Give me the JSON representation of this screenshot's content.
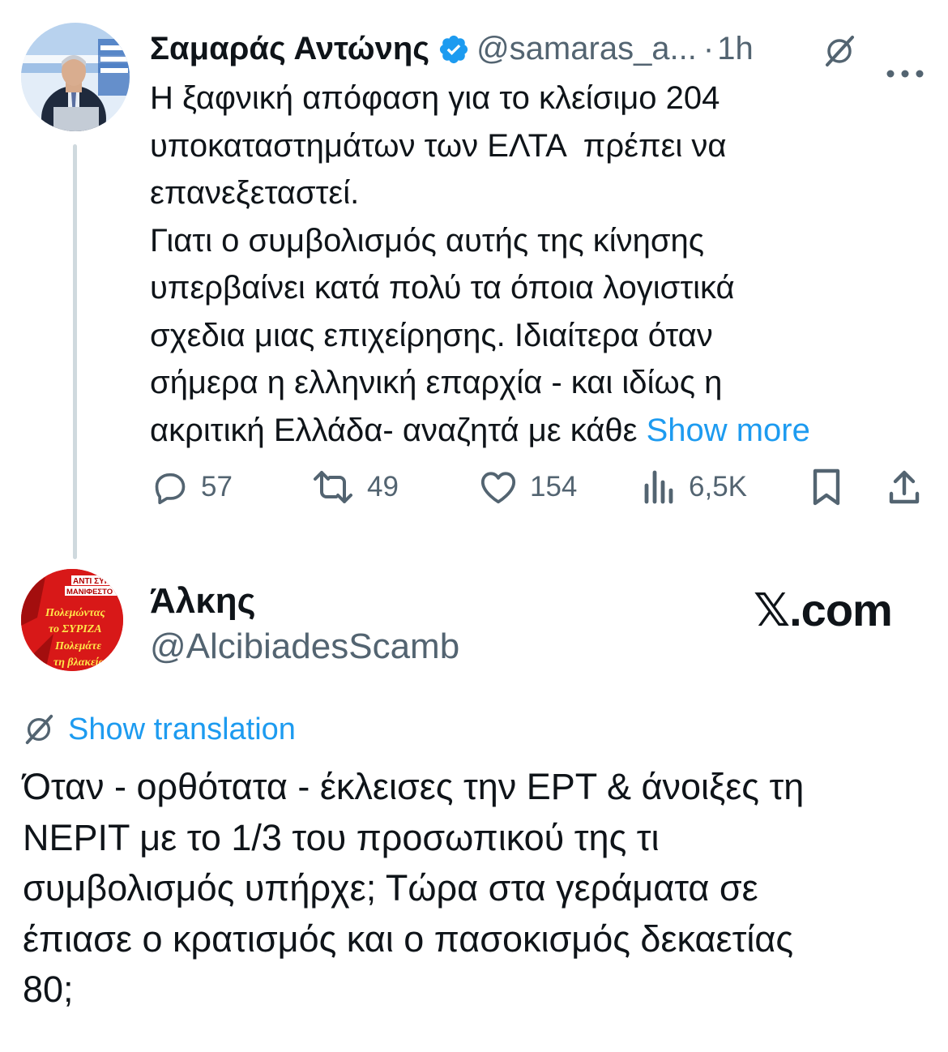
{
  "tweet1": {
    "author_name": "Σαμαράς Αντώνης",
    "verified": true,
    "handle": "@samaras_a...",
    "separator": "·",
    "time": "1h",
    "text_lines": [
      "Η ξαφνική απόφαση για το κλείσιμο 204",
      "υποκαταστημάτων των ΕΛΤΑ  πρέπει να",
      "επανεξεταστεί.",
      "Γιατι ο συμβολισμός αυτής της κίνησης",
      "υπερβαίνει κατά πολύ τα όποια λογιστικά",
      "σχεδια μιας επιχείρησης. Ιδιαίτερα όταν",
      "σήμερα η ελληνική επαρχία - και ιδίως η",
      "ακριτική Ελλάδα- αναζητά με κάθε"
    ],
    "show_more": "Show more",
    "stats": {
      "replies": "57",
      "reposts": "49",
      "likes": "154",
      "views": "6,5K"
    },
    "icons": [
      "grok-icon",
      "more-icon",
      "reply-icon",
      "repost-icon",
      "like-icon",
      "views-icon",
      "bookmark-icon",
      "share-icon"
    ]
  },
  "tweet2": {
    "author_name": "Άλκης",
    "handle": "@AlcibiadesScamb",
    "watermark": "𝕏.com",
    "show_translation": "Show translation",
    "avatar_text": [
      "ΑΝΤΙ ΣΥΡΙΖΑ",
      "ΜΑΝΙΦΕΣΤΟ",
      "Πολεμώντας",
      "το ΣΥΡΙΖΑ",
      "Πολεμάτε",
      "τη βλακεία"
    ],
    "text_lines": [
      "Όταν - ορθότατα - έκλεισες την ΕΡΤ & άνοιξες τη",
      "ΝΕΡΙΤ με το 1/3 του προσωπικού της τι",
      "συμβολισμός υπήρχε; Τώρα στα γεράματα σε",
      "έπιασε ο κρατισμός και ο πασοκισμός δεκαετίας",
      "80;"
    ]
  },
  "colors": {
    "link": "#1d9bf0",
    "secondary_text": "#536471",
    "primary_text": "#0f1419",
    "verified_badge": "#1d9bf0",
    "thread_line": "#cfd9de"
  }
}
